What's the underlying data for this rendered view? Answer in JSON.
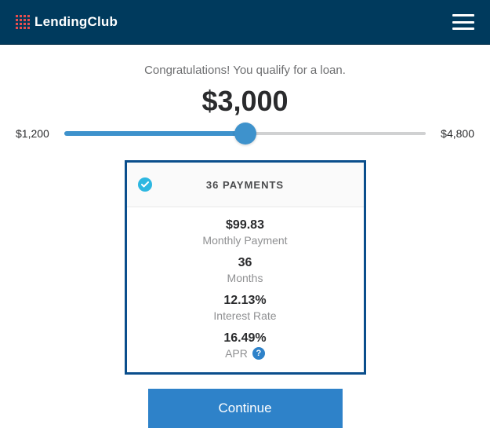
{
  "brand": "LendingClub",
  "message": "Congratulations! You qualify for a loan.",
  "amount": "$3,000",
  "slider": {
    "min_label": "$1,200",
    "max_label": "$4,800",
    "min": 1200,
    "max": 4800,
    "value": 3000
  },
  "offer": {
    "title": "36 PAYMENTS",
    "monthly_payment": {
      "value": "$99.83",
      "label": "Monthly Payment"
    },
    "months": {
      "value": "36",
      "label": "Months"
    },
    "interest_rate": {
      "value": "12.13%",
      "label": "Interest Rate"
    },
    "apr": {
      "value": "16.49%",
      "label": "APR"
    }
  },
  "cta": "Continue",
  "colors": {
    "header_bg": "#003a5d",
    "primary": "#2e82c9",
    "card_border": "#0a4e8c"
  }
}
